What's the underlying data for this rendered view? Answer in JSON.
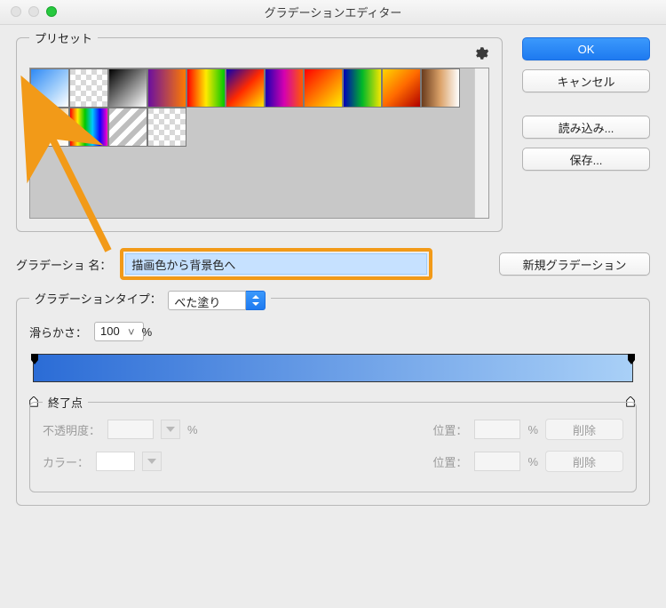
{
  "window": {
    "title": "グラデーションエディター"
  },
  "presets": {
    "label": "プリセット"
  },
  "side": {
    "ok": "OK",
    "cancel": "キャンセル",
    "load": "読み込み...",
    "save": "保存..."
  },
  "gradient": {
    "name_label": "グラデーショ   名：",
    "name_value": "描画色から背景色へ",
    "new_button": "新規グラデーション"
  },
  "type": {
    "label": "グラデーションタイプ：",
    "value": "べた塗り",
    "smooth_label": "滑らかさ：",
    "smooth_value": "100",
    "smooth_unit": "%"
  },
  "ramp": {
    "start_color": "#2b6cd6",
    "end_color": "#a9d0f7"
  },
  "stops": {
    "label": "終了点",
    "opacity_label": "不透明度：",
    "opacity_unit": "%",
    "color_label": "カラー：",
    "position_label": "位置：",
    "position_unit": "%",
    "delete": "削除"
  },
  "swatches": [
    {
      "css": "linear-gradient(135deg,#2f8af5,#a6d1fb 60%,#fff)"
    },
    {
      "css": "repeating-conic-gradient(#fff 0 25%,#d8d8d8 0 50%) 0 0/12px 12px,linear-gradient(135deg,#2f8af5,rgba(255,255,255,0))"
    },
    {
      "css": "linear-gradient(135deg,#000,#fff)"
    },
    {
      "css": "linear-gradient(to right,#6b0fa0,#ff7a00)"
    },
    {
      "css": "linear-gradient(to right,#ff0000,#ffea00,#00c800)"
    },
    {
      "css": "linear-gradient(135deg,#0a00b0,#ff2a00,#ffe600)"
    },
    {
      "css": "linear-gradient(to right,#1d00b0,#d400b0,#ff5a00)"
    },
    {
      "css": "linear-gradient(135deg,#ff0000,#ffee00)"
    },
    {
      "css": "linear-gradient(to right,#0000b8,#00b828,#f6e600)"
    },
    {
      "css": "linear-gradient(135deg,#ffd400,#ff6a00,#b00000)"
    },
    {
      "css": "linear-gradient(to right,#6b3c1d,#dca36a,#fff)"
    },
    {
      "css": "linear-gradient(135deg,#8a5a2a,#f3e2c4,#fff)"
    },
    {
      "css": "linear-gradient(to right,#ff0000,#ffea00,#00c800,#00c8ff,#1100ff,#ff00c8)"
    },
    {
      "css": "repeating-linear-gradient(135deg,#bebebe 0 6px,#fff 6px 12px)"
    },
    {
      "css": "repeating-conic-gradient(#fff 0 25%,#d8d8d8 0 50%) 0 0/12px 12px"
    }
  ]
}
